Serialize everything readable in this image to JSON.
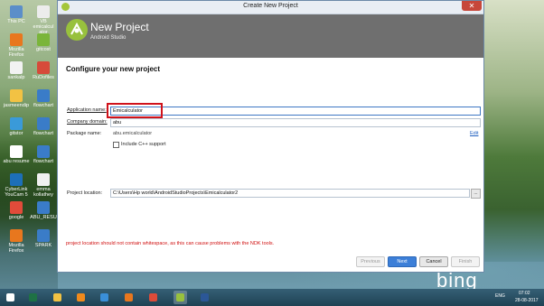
{
  "desktop": {
    "icons": [
      {
        "label": "This PC",
        "color": "#5b8ec9"
      },
      {
        "label": "Mozilla Firefox",
        "color": "#e8771e"
      },
      {
        "label": "sankalp",
        "color": "#f2f2f2"
      },
      {
        "label": "jasmeendip",
        "color": "#f2c243"
      },
      {
        "label": "gitstor",
        "color": "#3a9ad9"
      },
      {
        "label": "abu resume",
        "color": "#ffffff"
      },
      {
        "label": "CyberLink YouCam 5",
        "color": "#1d6fb8"
      },
      {
        "label": "google",
        "color": "#e14b3a"
      },
      {
        "label": "Mozilla Firefox",
        "color": "#e8771e"
      },
      {
        "label": "VB emicalcul ator",
        "color": "#ececec"
      },
      {
        "label": "gitcost",
        "color": "#7ab53a"
      },
      {
        "label": "RuDofiles",
        "color": "#d64a3a"
      },
      {
        "label": "flowchart",
        "color": "#3a7cc8"
      },
      {
        "label": "flowchart",
        "color": "#3a7cc8"
      },
      {
        "label": "flowchart",
        "color": "#3a7cc8"
      },
      {
        "label": "emma kollathey",
        "color": "#f0f0f0"
      },
      {
        "label": "ABU_RESU",
        "color": "#3a7cc8"
      },
      {
        "label": "SPARK",
        "color": "#3a7cc8"
      }
    ],
    "bing_text": "bing"
  },
  "window": {
    "title": "Create New Project",
    "close_glyph": "✕",
    "header": {
      "title": "New Project",
      "subtitle": "Android Studio"
    },
    "heading": "Configure your new project",
    "fields": {
      "app_name_label": "Application name:",
      "app_name_value": "Emicalculator",
      "company_domain_label": "Company domain:",
      "company_domain_value": "abu",
      "package_name_label": "Package name:",
      "package_name_value": "abu.emicalculator",
      "edit_link": "Edit",
      "cpp_support_label": "Include C++ support",
      "project_location_label": "Project location:",
      "project_location_value": "C:\\Users\\Hp world\\AndroidStudioProjects\\Emicalculator2",
      "browse_glyph": "..."
    },
    "warning": "project location should not contain whitespace, as this can cause problems with the NDK tools.",
    "buttons": {
      "previous": "Previous",
      "next": "Next",
      "cancel": "Cancel",
      "finish": "Finish"
    }
  },
  "taskbar": {
    "apps": [
      {
        "name": "start-button",
        "color": "#ffffff"
      },
      {
        "name": "excel",
        "color": "#1e7145"
      },
      {
        "name": "file-explorer",
        "color": "#f2c243"
      },
      {
        "name": "vlc",
        "color": "#f08a1c"
      },
      {
        "name": "internet-explorer",
        "color": "#3a8fd9"
      },
      {
        "name": "firefox",
        "color": "#e8771e"
      },
      {
        "name": "chrome",
        "color": "#dd4b39"
      },
      {
        "name": "android-studio",
        "color": "#98c13d"
      },
      {
        "name": "word",
        "color": "#2b5797"
      }
    ],
    "language": "ENG",
    "time": "07:02",
    "date": "28-08-2017"
  }
}
